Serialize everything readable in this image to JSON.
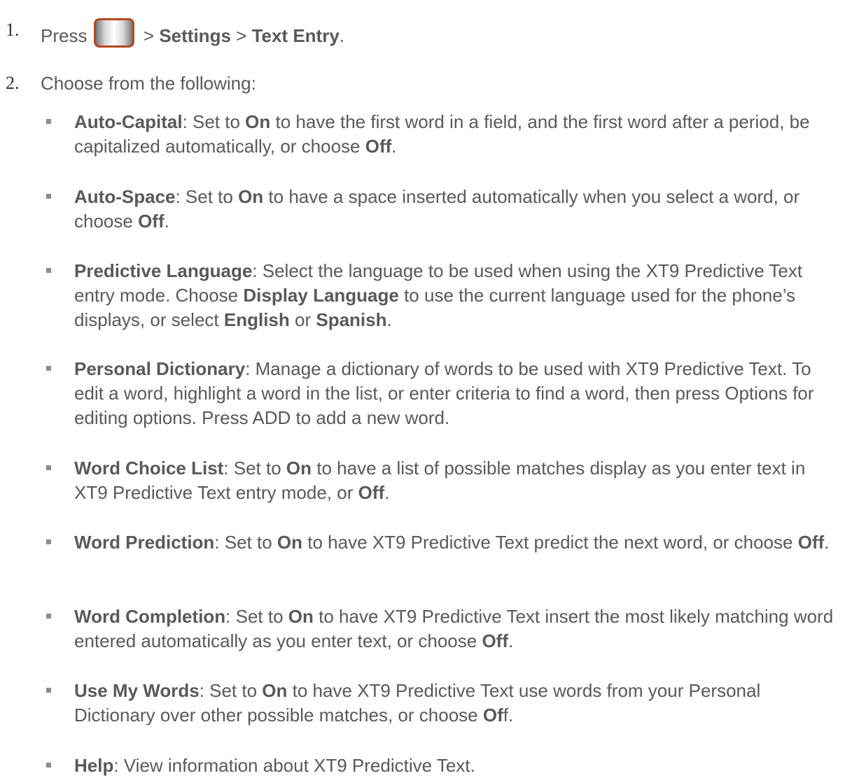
{
  "steps": [
    {
      "number": "1.",
      "press": "Press",
      "sep1": " > ",
      "settings": "Settings",
      "sep2": " > ",
      "text_entry": "Text Entry",
      "end": ".",
      "menu_key_icon": "menu-key-icon"
    },
    {
      "number": "2.",
      "text": "Choose from the following:"
    }
  ],
  "options": [
    {
      "name": "Auto-Capital",
      "t1": ": Set to ",
      "b1": "On",
      "t2": " to have the first word in a field, and the first word after a period, be capitalized automatically, or choose ",
      "b2": "Off",
      "t3": "."
    },
    {
      "name": "Auto-Space",
      "t1": ": Set to ",
      "b1": "On",
      "t2": " to have a space inserted automatically when you select a word, or choose ",
      "b2": "Off",
      "t3": "."
    },
    {
      "name": "Predictive Language",
      "t1": ": Select the language to be used when using the XT9 Predictive Text entry mode. Choose ",
      "b1": "Display Language",
      "t2": " to use the current language used for the phone’s displays, or select ",
      "b2": "English",
      "t3": " or ",
      "b3": "Spanish",
      "t4": "."
    },
    {
      "name": "Personal Dictionary",
      "t1": ": Manage a dictionary of words to be used with XT9 Predictive Text. To edit a word, highlight a word in the list, or enter criteria to find a word, then press Options for editing options. Press ADD to add a new word."
    },
    {
      "name": "Word Choice List",
      "t1": ": Set to ",
      "b1": "On",
      "t2": " to have a list of possible matches display as you enter text in XT9 Predictive Text entry mode, or ",
      "b2": "Off",
      "t3": "."
    },
    {
      "name": "Word Prediction",
      "t1": ": Set to ",
      "b1": "On",
      "t2": " to have XT9 Predictive Text predict the next word, or choose ",
      "b2": "Off",
      "t3": "."
    },
    {
      "name": "Word Completion",
      "t1": ": Set to ",
      "b1": "On",
      "t2": " to have XT9 Predictive Text insert the most likely matching word entered automatically as you enter text, or choose ",
      "b2": "Off",
      "t3": "."
    },
    {
      "name": "Use My Words",
      "t1": ": Set to ",
      "b1": "On",
      "t2": " to have XT9 Predictive Text use words from your Personal Dictionary over other possible matches, or choose ",
      "b2": "Of",
      "t3": "f."
    },
    {
      "name": "Help",
      "t1": ": View information about XT9 Predictive Text."
    }
  ],
  "colors": {
    "text": "#595959",
    "number": "#333333",
    "bullet": "#8c8c8c",
    "menu_key_border": "#b4481a"
  }
}
